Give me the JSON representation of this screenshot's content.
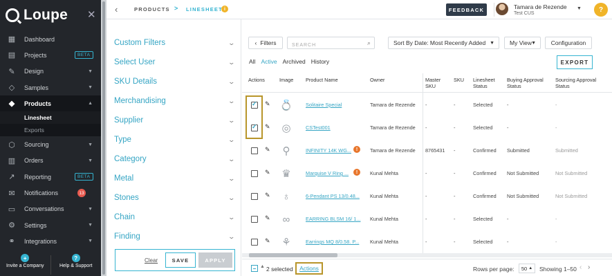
{
  "app": {
    "logo_text": "Loupe"
  },
  "sidebar": {
    "items": [
      {
        "label": "Dashboard",
        "icon": "dashboard-icon",
        "glyph": "▦"
      },
      {
        "label": "Projects",
        "icon": "projects-icon",
        "glyph": "▤",
        "badge": "BETA"
      },
      {
        "label": "Design",
        "icon": "design-icon",
        "glyph": "✎",
        "caret": true
      },
      {
        "label": "Samples",
        "icon": "diamond-icon",
        "glyph": "◇",
        "caret": true
      },
      {
        "label": "Products",
        "icon": "gem-icon",
        "glyph": "◆",
        "caret": true,
        "active": true
      },
      {
        "label": "Sourcing",
        "icon": "sourcing-icon",
        "glyph": "⬡",
        "caret": true
      },
      {
        "label": "Orders",
        "icon": "orders-icon",
        "glyph": "▥",
        "caret": true
      },
      {
        "label": "Reporting",
        "icon": "reporting-icon",
        "glyph": "↗",
        "badge": "BETA"
      },
      {
        "label": "Notifications",
        "icon": "notifications-icon",
        "glyph": "✉",
        "count": "13"
      },
      {
        "label": "Conversations",
        "icon": "conversations-icon",
        "glyph": "▭",
        "caret": true
      },
      {
        "label": "Settings",
        "icon": "settings-icon",
        "glyph": "⚙",
        "caret": true
      },
      {
        "label": "Integrations",
        "icon": "integrations-icon",
        "glyph": "⚭",
        "caret": true
      }
    ],
    "sub_items": [
      {
        "label": "Linesheet",
        "active": true
      },
      {
        "label": "Exports"
      }
    ],
    "bottom": {
      "invite_label": "Invite a Company",
      "help_label": "Help & Support"
    }
  },
  "header": {
    "crumb_1": "PRODUCTS",
    "crumb_sep": ">",
    "crumb_2": "LINESHEET",
    "feedback_label": "FEEDBACK",
    "user_name": "Tamara de Rezende",
    "user_org": "Test CUS",
    "help_glyph": "?"
  },
  "filters": {
    "items": [
      "Custom Filters",
      "Select User",
      "SKU Details",
      "Merchandising",
      "Supplier",
      "Type",
      "Category",
      "Metal",
      "Stones",
      "Chain",
      "Finding"
    ],
    "clear_label": "Clear",
    "save_label": "SAVE",
    "apply_label": "APPLY"
  },
  "toolbar": {
    "filters_label": "Filters",
    "search_placeholder": "SEARCH",
    "sort_label": "Sort By Date: Most Recently Added",
    "view_label": "My View",
    "config_label": "Configuration",
    "export_label": "EXPORT",
    "tabs": [
      "All",
      "Active",
      "Archived",
      "History"
    ],
    "active_tab": "Active"
  },
  "table": {
    "columns": [
      "Actions",
      "Image",
      "Product Name",
      "Owner",
      "Master SKU",
      "SKU",
      "Linesheet Status",
      "Buying Approval Status",
      "Sourcing Approval Status"
    ],
    "rows": [
      {
        "checked": true,
        "image": "ring",
        "glyph": "💍",
        "name": "Solitaire Special",
        "warn": false,
        "owner": "Tamara de Rezende",
        "master_sku": "-",
        "sku": "-",
        "linesheet": "Selected",
        "buying": "-",
        "sourcing": "-"
      },
      {
        "checked": true,
        "image": "ring",
        "glyph": "◎",
        "name": "CSTest001",
        "warn": false,
        "owner": "Tamara de Rezende",
        "master_sku": "-",
        "sku": "-",
        "linesheet": "Selected",
        "buying": "-",
        "sourcing": "-"
      },
      {
        "checked": false,
        "image": "necklace",
        "glyph": "⚲",
        "name": "INFINITY 14K WG...",
        "warn": true,
        "owner": "Tamara de Rezende",
        "master_sku": "8765431",
        "sku": "-",
        "linesheet": "Confirmed",
        "buying": "Submitted",
        "sourcing": "Submitted"
      },
      {
        "checked": false,
        "image": "ring",
        "glyph": "♛",
        "name": "Marquise V Ring ...",
        "warn": true,
        "owner": "Kunal Mehta",
        "master_sku": "-",
        "sku": "-",
        "linesheet": "Confirmed",
        "buying": "Not Submitted",
        "sourcing": "Not Submitted"
      },
      {
        "checked": false,
        "image": "pendant",
        "glyph": "♁",
        "name": "6-Pendant PS 13/0.48...",
        "warn": false,
        "owner": "Kunal Mehta",
        "master_sku": "-",
        "sku": "-",
        "linesheet": "Confirmed",
        "buying": "Not Submitted",
        "sourcing": "Not Submitted"
      },
      {
        "checked": false,
        "image": "earring",
        "glyph": "∞",
        "name": "EARRING BLSM 16/ 1...",
        "warn": false,
        "owner": "Kunal Mehta",
        "master_sku": "-",
        "sku": "-",
        "linesheet": "Selected",
        "buying": "-",
        "sourcing": "-"
      },
      {
        "checked": false,
        "image": "earring",
        "glyph": "⚘",
        "name": "Earrings MQ 8/0.58. P...",
        "warn": false,
        "owner": "Kunal Mehta",
        "master_sku": "-",
        "sku": "-",
        "linesheet": "Selected",
        "buying": "-",
        "sourcing": "-"
      }
    ]
  },
  "footer": {
    "selected_label": "2 selected",
    "actions_label": "Actions",
    "rows_per_page_label": "Rows per page:",
    "rows_per_page_value": "50",
    "showing_label": "Showing 1–50"
  }
}
